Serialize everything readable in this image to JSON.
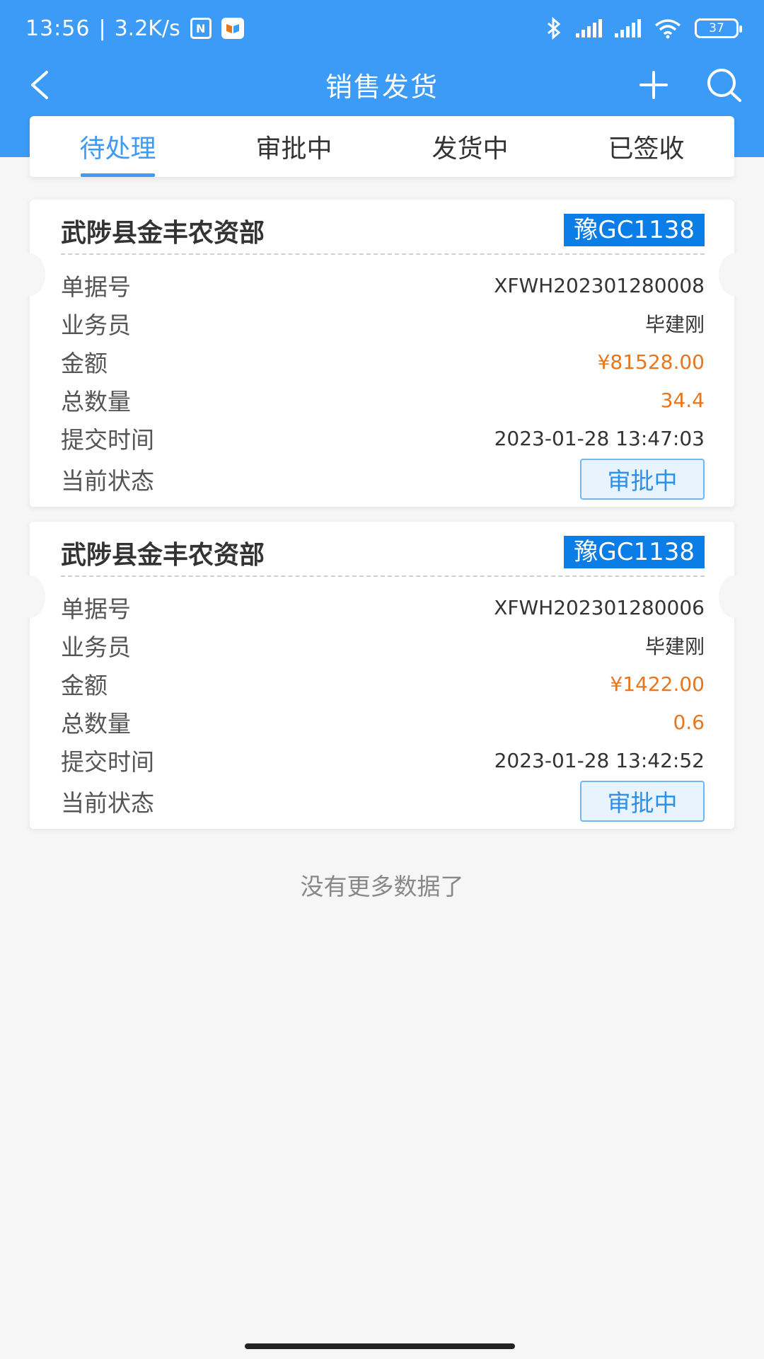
{
  "status_bar": {
    "time": "13:56",
    "separator": "|",
    "net_speed": "3.2K/s",
    "battery": "37",
    "icons": [
      "nfc-icon",
      "app-notification-icon",
      "bluetooth-icon",
      "signal-hd-icon",
      "signal-hd-icon",
      "wifi-icon",
      "battery-icon"
    ]
  },
  "nav": {
    "title": "销售发货",
    "icons": [
      "back-icon",
      "plus-icon",
      "search-icon"
    ]
  },
  "tabs": [
    {
      "label": "待处理",
      "active": true
    },
    {
      "label": "审批中",
      "active": false
    },
    {
      "label": "发货中",
      "active": false
    },
    {
      "label": "已签收",
      "active": false
    }
  ],
  "cards": [
    {
      "title": "武陟县金丰农资部",
      "plate": "豫GC1138",
      "fields": [
        {
          "label": "单据号",
          "value": "XFWH202301280008"
        },
        {
          "label": "业务员",
          "value": "毕建刚"
        },
        {
          "label": "金额",
          "value": "¥81528.00"
        },
        {
          "label": "总数量",
          "value": "34.4"
        },
        {
          "label": "提交时间",
          "value": "2023-01-28 13:47:03"
        }
      ],
      "status_label": "当前状态",
      "status": "审批中"
    },
    {
      "title": "武陟县金丰农资部",
      "plate": "豫GC1138",
      "fields": [
        {
          "label": "单据号",
          "value": "XFWH202301280006"
        },
        {
          "label": "业务员",
          "value": "毕建刚"
        },
        {
          "label": "金额",
          "value": "¥1422.00"
        },
        {
          "label": "总数量",
          "value": "0.6"
        },
        {
          "label": "提交时间",
          "value": "2023-01-28 13:42:52"
        }
      ],
      "status_label": "当前状态",
      "status": "审批中"
    }
  ],
  "footer": {
    "no_more": "没有更多数据了"
  },
  "colors": {
    "primary": "#3b9bf6",
    "plate_bg": "#0a7de6",
    "amount": "#e8761d",
    "status_border": "#6fb6f3",
    "status_bg": "#e8f4fd"
  }
}
